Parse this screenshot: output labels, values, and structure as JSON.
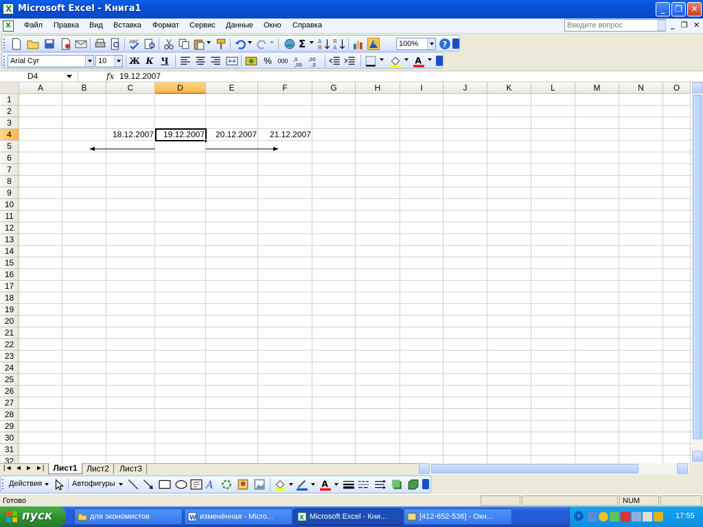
{
  "window": {
    "title": "Microsoft Excel - Книга1"
  },
  "menu": {
    "items": [
      "Файл",
      "Правка",
      "Вид",
      "Вставка",
      "Формат",
      "Сервис",
      "Данные",
      "Окно",
      "Справка"
    ],
    "help_placeholder": "Введите вопрос"
  },
  "toolbar": {
    "zoom": "100%"
  },
  "format_toolbar": {
    "font": "Arial Cyr",
    "size": "10",
    "bold": "Ж",
    "italic": "К",
    "underline": "Ч",
    "percent": "%",
    "thousands": "000"
  },
  "formula_bar": {
    "name_box": "D4",
    "fx": "fx",
    "value": "19.12.2007"
  },
  "sheet": {
    "columns": [
      "A",
      "B",
      "C",
      "D",
      "E",
      "F",
      "G",
      "H",
      "I",
      "J",
      "K",
      "L",
      "M",
      "N",
      "O"
    ],
    "rows": [
      "1",
      "2",
      "3",
      "4",
      "5",
      "6",
      "7",
      "8",
      "9",
      "10",
      "11",
      "12",
      "13",
      "14",
      "15",
      "16",
      "17",
      "18",
      "19",
      "20",
      "21",
      "22",
      "23",
      "24",
      "25",
      "26",
      "27",
      "28",
      "29",
      "30",
      "31",
      "32"
    ],
    "selected_cell": "D4",
    "cells": {
      "C4": "18.12.2007",
      "D4": "19.12.2007",
      "E4": "20.12.2007",
      "F4": "21.12.2007"
    }
  },
  "tabs": [
    "Лист1",
    "Лист2",
    "Лист3"
  ],
  "drawing_toolbar": {
    "actions": "Действия",
    "autoshapes": "Автофигуры"
  },
  "status": {
    "ready": "Готово",
    "num": "NUM"
  },
  "taskbar": {
    "start": "пуск",
    "tasks": [
      "для экономистов",
      "изменённая - Micro...",
      "Microsoft Excel - Кни...",
      "[412-652-536] - Окн..."
    ],
    "time": "17:55"
  },
  "colors": {
    "title_blue": "#0B4FD6",
    "selected_header": "#F9B64B",
    "start_green": "#2E8B2E",
    "taskbar_blue": "#245EDB"
  }
}
